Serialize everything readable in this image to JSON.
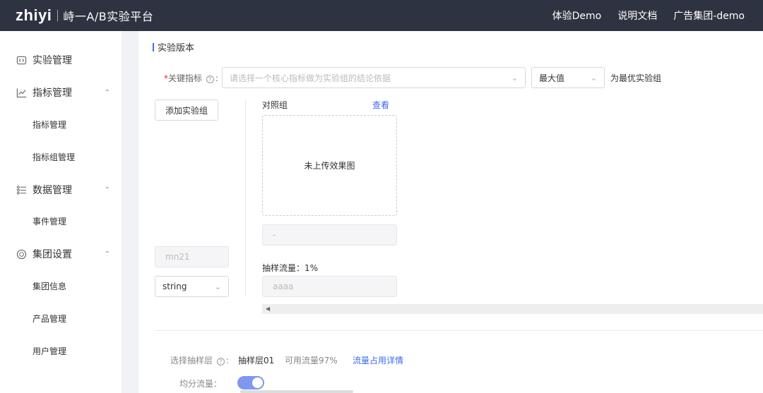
{
  "header": {
    "logo": "zhiyi",
    "subtitle": "峙一A/B实验平台",
    "nav": [
      "体验Demo",
      "说明文档",
      "广告集团-demo"
    ]
  },
  "sidebar": {
    "groups": [
      {
        "label": "实验管理",
        "icon": "code-box-icon"
      },
      {
        "label": "指标管理",
        "icon": "line-chart-icon",
        "children": [
          "指标管理",
          "指标组管理"
        ]
      },
      {
        "label": "数据管理",
        "icon": "list-icon",
        "children": [
          "事件管理"
        ]
      },
      {
        "label": "集团设置",
        "icon": "globe-icon",
        "children": [
          "集团信息",
          "产品管理",
          "用户管理"
        ]
      }
    ]
  },
  "main": {
    "section_title": "实验版本",
    "key_metric_label": "关键指标",
    "key_metric_placeholder": "请选择一个核心指标做为实验组的结论依据",
    "optimum_select": "最大值",
    "optimum_suffix": "为最优实验组",
    "add_group_button": "添加实验组",
    "control_group_label": "对照组",
    "view_link": "查看",
    "upload_placeholder": "未上传效果图",
    "control_name_value": "-",
    "param_name_value": "mn21",
    "param_type_value": "string",
    "sample_traffic_label": "抽样流量：",
    "sample_traffic_value": "1%",
    "param_value_value": "aaaa",
    "layer_label": "选择抽样层",
    "layer_value": "抽样层01",
    "available_traffic": "可用流量97%",
    "traffic_detail_link": "流量占用详情",
    "even_split_label": "均分流量："
  },
  "colors": {
    "topbar": "#2d3340",
    "accent": "#3b6cf0",
    "toggle": "#7f97ee"
  }
}
